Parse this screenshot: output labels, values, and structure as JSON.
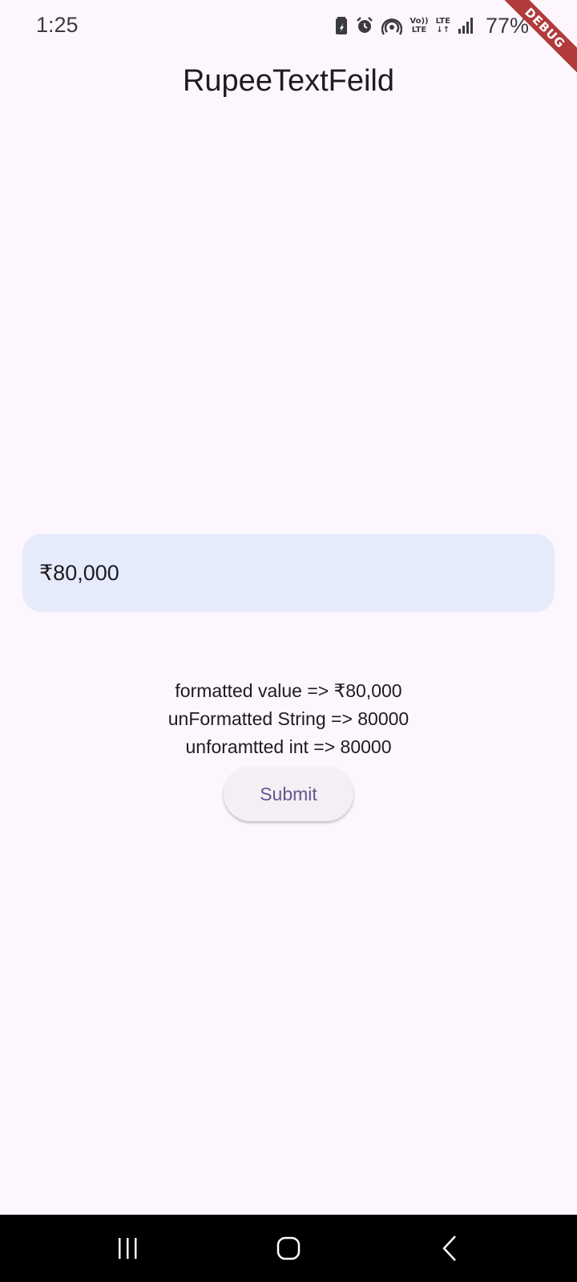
{
  "status_bar": {
    "time": "1:25",
    "battery": "77%",
    "lte_top": "Vo))",
    "lte_bottom": "LTE",
    "lte2": "LTE",
    "icons": [
      "battery-saver-icon",
      "alarm-icon",
      "hotspot-icon",
      "volte-icon",
      "lte-data-icon",
      "signal-icon"
    ]
  },
  "debug_banner": "DEBUG",
  "app_bar": {
    "title": "RupeeTextFeild"
  },
  "amount_field": {
    "value": "₹80,000"
  },
  "results": {
    "formatted": "formatted value => ₹80,000",
    "unformatted_string": "unFormatted String => 80000",
    "unformatted_int": "unforamtted int => 80000"
  },
  "submit_label": "Submit",
  "nav_bar": {
    "icons": [
      "recents-icon",
      "home-icon",
      "back-icon"
    ]
  },
  "colors": {
    "background": "#fdf7fd",
    "field_fill": "#e6ebfc",
    "button_text": "#65558f",
    "debug_ribbon": "#b13a3a"
  }
}
